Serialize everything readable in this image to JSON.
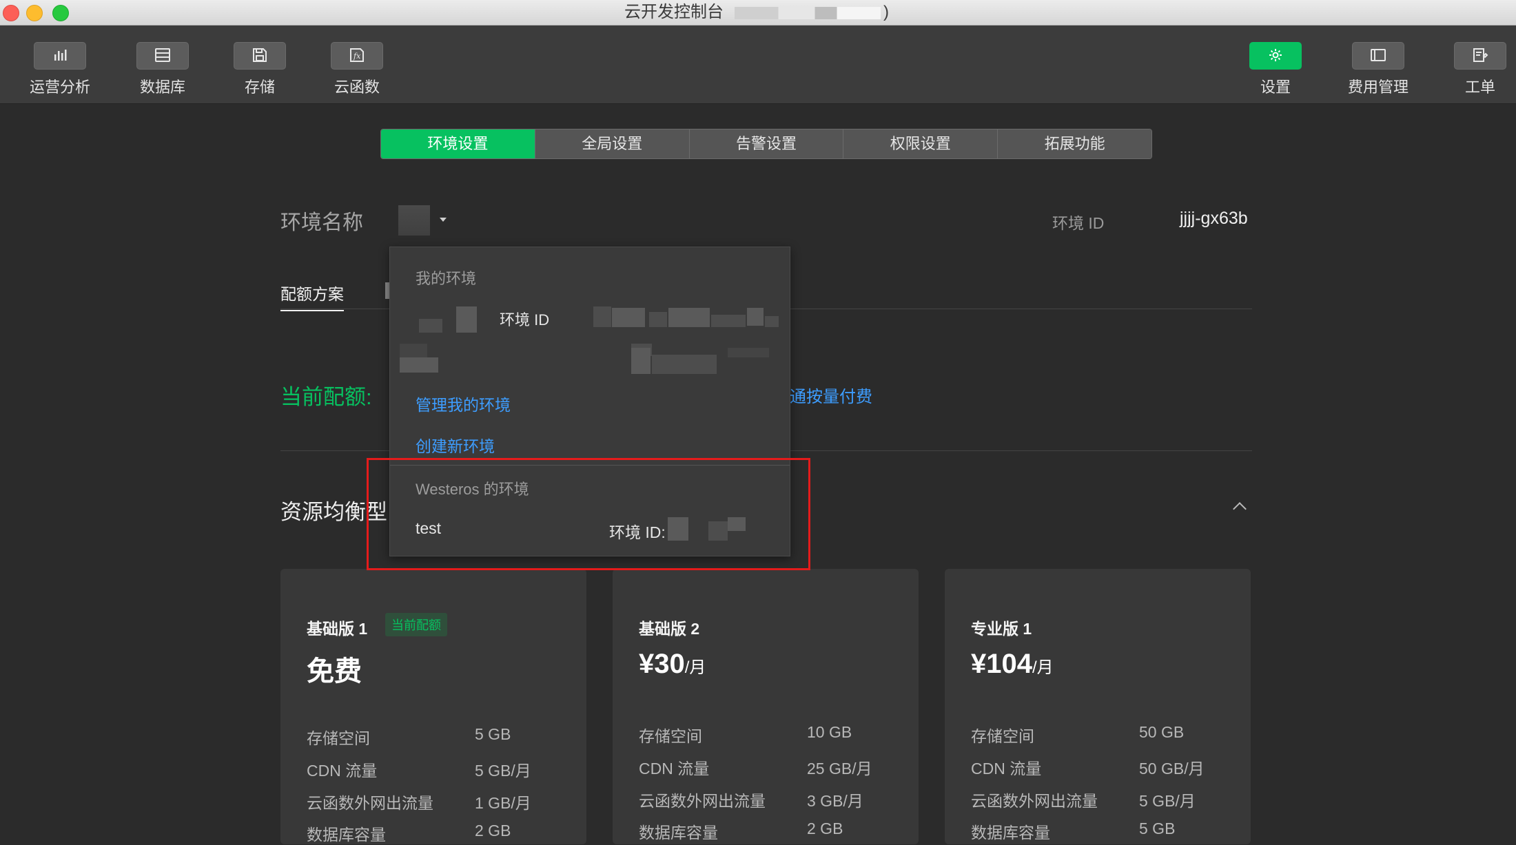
{
  "window": {
    "title": "云开发控制台",
    "title_suffix": ")"
  },
  "toolbar": {
    "left": [
      {
        "label": "运营分析",
        "icon": "bar-chart-icon"
      },
      {
        "label": "数据库",
        "icon": "database-icon"
      },
      {
        "label": "存储",
        "icon": "floppy-disk-icon"
      },
      {
        "label": "云函数",
        "icon": "function-icon"
      }
    ],
    "right": [
      {
        "label": "设置",
        "icon": "gear-icon"
      },
      {
        "label": "费用管理",
        "icon": "billing-icon"
      },
      {
        "label": "工单",
        "icon": "ticket-icon"
      }
    ]
  },
  "tabs": [
    "环境设置",
    "全局设置",
    "告警设置",
    "权限设置",
    "拓展功能"
  ],
  "env": {
    "name_label": "环境名称",
    "id_label": "环境 ID",
    "id_value": "jjjj-gx63b"
  },
  "subtabs": {
    "active": "配额方案"
  },
  "quota": {
    "label": "当前配额:",
    "link": "通按量付费"
  },
  "plan_type": "资源均衡型",
  "dropdown": {
    "my_envs_header": "我的环境",
    "my_env_id_label": "环境 ID",
    "manage_link": "管理我的环境",
    "create_link": "创建新环境",
    "shared_header": "Westeros 的环境",
    "shared_env_name": "test",
    "shared_env_id_label": "环境 ID:"
  },
  "cards": [
    {
      "title": "基础版 1",
      "badge": "当前配额",
      "price": "免费",
      "unit": "",
      "specs": [
        {
          "k": "存储空间",
          "v": "5 GB"
        },
        {
          "k": "CDN 流量",
          "v": "5 GB/月"
        },
        {
          "k": "云函数外网出流量",
          "v": "1 GB/月"
        },
        {
          "k": "数据库容量",
          "v": "2 GB"
        }
      ]
    },
    {
      "title": "基础版 2",
      "badge": "",
      "price": "¥30",
      "unit": "/月",
      "specs": [
        {
          "k": "存储空间",
          "v": "10 GB"
        },
        {
          "k": "CDN 流量",
          "v": "25 GB/月"
        },
        {
          "k": "云函数外网出流量",
          "v": "3 GB/月"
        },
        {
          "k": "数据库容量",
          "v": "2 GB"
        }
      ]
    },
    {
      "title": "专业版 1",
      "badge": "",
      "price": "¥104",
      "unit": "/月",
      "specs": [
        {
          "k": "存储空间",
          "v": "50 GB"
        },
        {
          "k": "CDN 流量",
          "v": "50 GB/月"
        },
        {
          "k": "云函数外网出流量",
          "v": "5 GB/月"
        },
        {
          "k": "数据库容量",
          "v": "5 GB"
        }
      ]
    }
  ],
  "colors": {
    "accent": "#07c160",
    "link": "#3d9dff",
    "highlight": "#e41b1b",
    "background": "#2b2b2b"
  }
}
